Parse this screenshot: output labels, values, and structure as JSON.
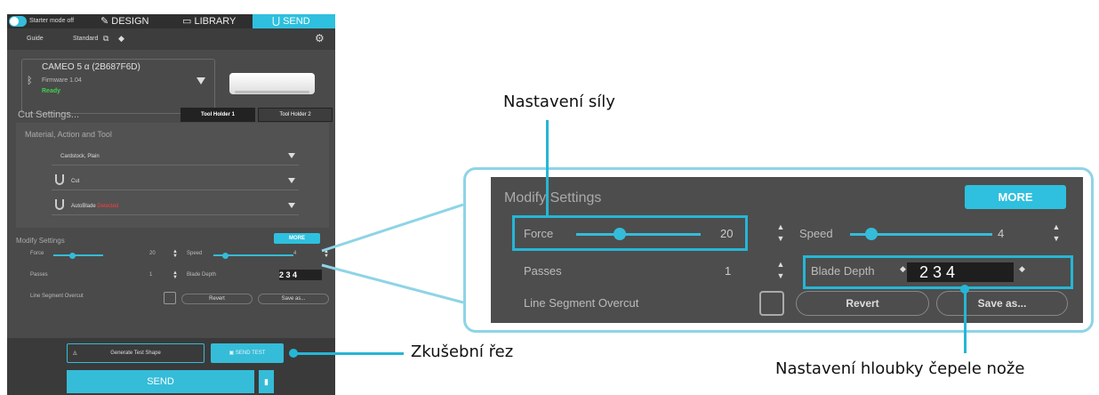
{
  "app": {
    "topbar": {
      "starter_mode": "Starter mode off",
      "tab_design": "DESIGN",
      "tab_library": "LIBRARY",
      "tab_send": "SEND"
    },
    "subbar": {
      "guide": "Guide",
      "standard": "Standard"
    },
    "device": {
      "name": "CAMEO 5 α (2B687F6D)",
      "firmware": "Firmware 1.04",
      "status": "Ready"
    },
    "cut_settings": {
      "label": "Cut Settings...",
      "tool_holder_1": "Tool Holder 1",
      "tool_holder_2": "Tool Holder 2"
    },
    "material_section": {
      "label": "Material, Action and Tool",
      "material": "Cardstock, Plain",
      "action": "Cut",
      "tool_prefix": "AutoBlade",
      "tool_status": "Detected"
    },
    "modify_small": {
      "title": "Modify Settings",
      "more": "MORE",
      "force_label": "Force",
      "force_value": "20",
      "speed_label": "Speed",
      "speed_value": "4",
      "passes_label": "Passes",
      "passes_value": "1",
      "blade_depth_label": "Blade Depth",
      "blade_digits": "2 3 4",
      "overcut_label": "Line Segment Overcut",
      "revert": "Revert",
      "save_as": "Save as..."
    },
    "bottom": {
      "generate": "Generate Test Shape",
      "send_test": "SEND TEST",
      "send": "SEND"
    }
  },
  "zoom": {
    "title": "Modify Settings",
    "more": "MORE",
    "force_label": "Force",
    "force_value": "20",
    "force_fraction": 0.35,
    "speed_label": "Speed",
    "speed_value": "4",
    "speed_fraction": 0.15,
    "passes_label": "Passes",
    "passes_value": "1",
    "blade_depth_label": "Blade Depth",
    "blade_digits": "2  3  4",
    "overcut_label": "Line Segment Overcut",
    "revert": "Revert",
    "save_as": "Save as..."
  },
  "callouts": {
    "force": "Nastavení síly",
    "test_cut": "Zkušební řez",
    "blade_depth": "Nastavení hloubky čepele nože"
  },
  "colors": {
    "accent": "#2ec0de",
    "highlight": "#25b6d6",
    "panel": "#4a4a4a",
    "ready": "#3fd14b",
    "detected": "#ff3b3b"
  }
}
